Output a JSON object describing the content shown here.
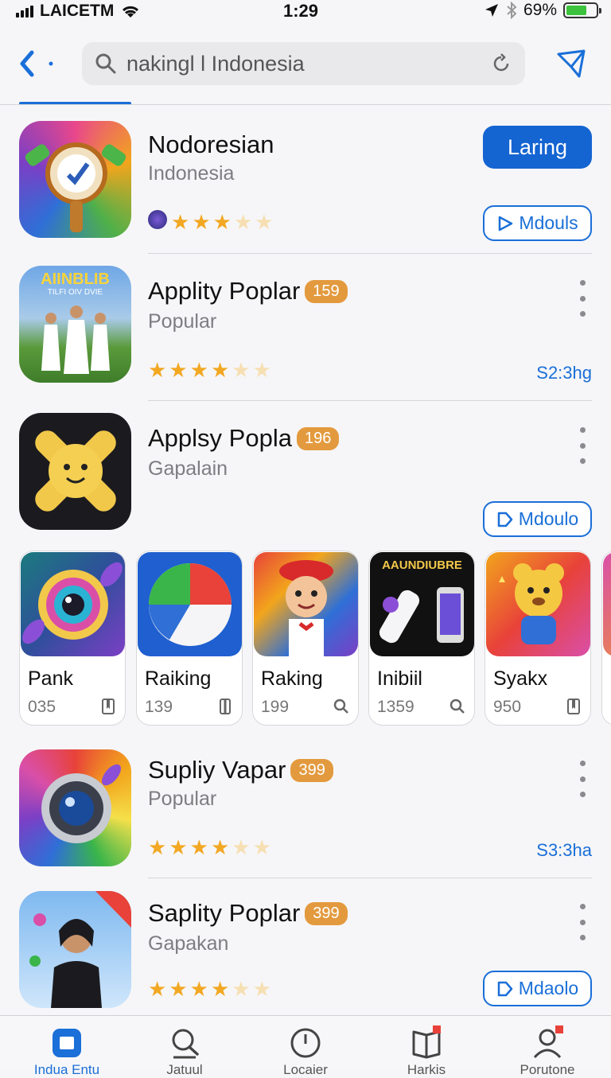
{
  "status": {
    "carrier": "LAICETM",
    "time": "1:29",
    "battery": "69%"
  },
  "search": {
    "value": "nakingl l Indonesia"
  },
  "featured": {
    "title": "Nodoresian",
    "subtitle": "Indonesia",
    "primary_label": "Laring",
    "secondary_label": "Mdouls",
    "rating": 3
  },
  "apps": [
    {
      "title": "Applity Poplar",
      "badge": "159",
      "subtitle": "Popular",
      "price": "S2:3hg",
      "rating": 4
    },
    {
      "title": "Applsy Popla",
      "badge": "196",
      "subtitle": "Gapalain",
      "button": "Mdoulo"
    },
    {
      "title": "Supliy Vapar",
      "badge": "399",
      "subtitle": "Popular",
      "price": "S3:3ha",
      "rating": 4
    },
    {
      "title": "Saplity Poplar",
      "badge": "399",
      "subtitle": "Gapakan",
      "button": "Mdaolo",
      "rating": 4
    }
  ],
  "app_icons": {
    "row2_title": "AIINBLIB",
    "row2_sub": "TILFI OIV DVIE"
  },
  "carousel": [
    {
      "name": "Pank",
      "count": "035"
    },
    {
      "name": "Raiking",
      "count": "139"
    },
    {
      "name": "Raking",
      "count": "199"
    },
    {
      "name": "Inibiil",
      "count": "1359",
      "art_title": "AAUNDIUBRE"
    },
    {
      "name": "Syakx",
      "count": "950"
    }
  ],
  "tabs": [
    {
      "label": "Indua Entu"
    },
    {
      "label": "Jatuul"
    },
    {
      "label": "Locaier"
    },
    {
      "label": "Harkis"
    },
    {
      "label": "Porutone"
    }
  ],
  "colors": {
    "accent": "#1a6fd8",
    "badge": "#e39a3e",
    "star": "#f2a823"
  }
}
